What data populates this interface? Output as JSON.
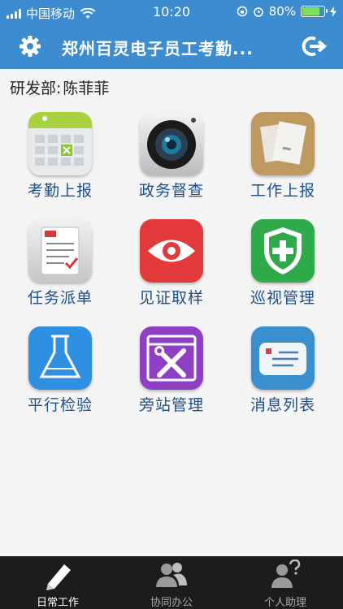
{
  "status_bar": {
    "carrier": "中国移动",
    "time": "10:20",
    "battery_text": "80%",
    "battery_level": 0.8
  },
  "header": {
    "title": "郑州百灵电子员工考勤..."
  },
  "user": {
    "department": "研发部:",
    "name": "陈菲菲"
  },
  "modules": [
    {
      "label": "考勤上报",
      "icon": "attendance-calendar-icon"
    },
    {
      "label": "政务督查",
      "icon": "camera-icon"
    },
    {
      "label": "工作上报",
      "icon": "documents-icon"
    },
    {
      "label": "任务派单",
      "icon": "task-clipboard-icon"
    },
    {
      "label": "见证取样",
      "icon": "eye-icon"
    },
    {
      "label": "巡视管理",
      "icon": "shield-plus-icon"
    },
    {
      "label": "平行检验",
      "icon": "flask-icon"
    },
    {
      "label": "旁站管理",
      "icon": "tools-icon"
    },
    {
      "label": "消息列表",
      "icon": "message-card-icon"
    }
  ],
  "tabs": [
    {
      "label": "日常工作",
      "icon": "pencil-icon",
      "active": true
    },
    {
      "label": "协同办公",
      "icon": "people-icon",
      "active": false
    },
    {
      "label": "个人助理",
      "icon": "assistant-icon",
      "active": false
    }
  ],
  "colors": {
    "header_bg": "#3d8ccf",
    "label_text": "#1f4f8a",
    "tabbar_bg": "#1c1c1c"
  }
}
